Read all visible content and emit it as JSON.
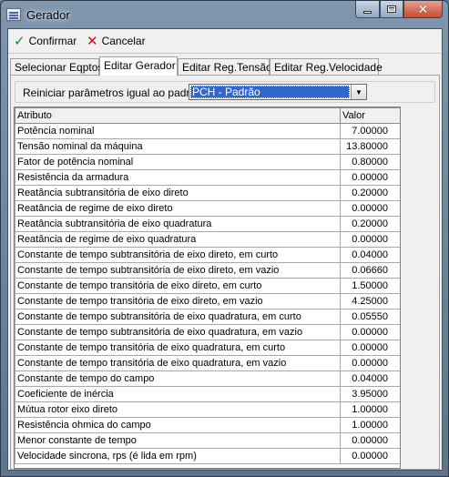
{
  "window": {
    "title": "Gerador"
  },
  "toolbar": {
    "confirm_label": "Confirmar",
    "cancel_label": "Cancelar"
  },
  "tabs": [
    {
      "label": "Selecionar Eqptos",
      "active": false
    },
    {
      "label": "Editar Gerador",
      "active": true
    },
    {
      "label": "Editar Reg.Tensão",
      "active": false
    },
    {
      "label": "Editar Reg.Velocidade",
      "active": false
    }
  ],
  "reset": {
    "label": "Reiniciar parâmetros igual ao padrão",
    "selected": "PCH - Padrão"
  },
  "grid": {
    "headers": {
      "attribute": "Atributo",
      "value": "Valor"
    },
    "rows": [
      {
        "attribute": "Potência nominal",
        "value": "7.00000"
      },
      {
        "attribute": "Tensão nominal da máquina",
        "value": "13.80000"
      },
      {
        "attribute": "Fator de potência nominal",
        "value": "0.80000"
      },
      {
        "attribute": "Resistência da armadura",
        "value": "0.00000"
      },
      {
        "attribute": "Reatância subtransitória de eixo direto",
        "value": "0.20000"
      },
      {
        "attribute": "Reatância de regime de eixo direto",
        "value": "0.00000"
      },
      {
        "attribute": "Reatância subtransitória de eixo quadratura",
        "value": "0.20000"
      },
      {
        "attribute": "Reatância de regime de eixo quadratura",
        "value": "0.00000"
      },
      {
        "attribute": "Constante de tempo subtransitória de eixo direto, em curto",
        "value": "0.04000"
      },
      {
        "attribute": "Constante de tempo subtransitória de eixo direto, em vazio",
        "value": "0.06660"
      },
      {
        "attribute": "Constante de tempo transitória de eixo direto, em curto",
        "value": "1.50000"
      },
      {
        "attribute": "Constante de tempo transitória de eixo direto, em vazio",
        "value": "4.25000"
      },
      {
        "attribute": "Constante de tempo subtransitória de eixo quadratura, em curto",
        "value": "0.05550"
      },
      {
        "attribute": "Constante de tempo subtransitória de eixo quadratura, em vazio",
        "value": "0.00000"
      },
      {
        "attribute": "Constante de tempo transitória de eixo quadratura, em curto",
        "value": "0.00000"
      },
      {
        "attribute": "Constante de tempo transitória de eixo quadratura, em vazio",
        "value": "0.00000"
      },
      {
        "attribute": "Constante de tempo do campo",
        "value": "0.04000"
      },
      {
        "attribute": "Coeficiente de inércia",
        "value": "3.95000"
      },
      {
        "attribute": "Mútua rotor eixo direto",
        "value": "1.00000"
      },
      {
        "attribute": "Resistência ohmica do campo",
        "value": "1.00000"
      },
      {
        "attribute": "Menor constante de tempo",
        "value": "0.00000"
      },
      {
        "attribute": "Velocidade sincrona, rps (é lida em rpm)",
        "value": "0.00000"
      }
    ]
  },
  "icons": {
    "app": "grid-app-icon",
    "confirm": "check-icon",
    "cancel": "x-icon",
    "dropdown": "chevron-down-icon"
  }
}
